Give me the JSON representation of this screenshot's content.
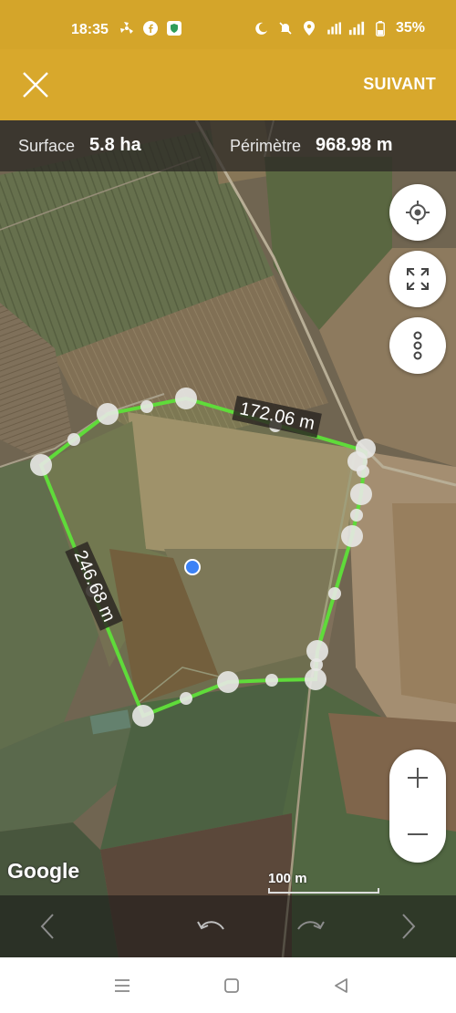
{
  "status_bar": {
    "time": "18:35",
    "battery": "35%",
    "icons_left": [
      "fan-icon",
      "facebook-icon",
      "shield-app-icon"
    ],
    "icons_right": [
      "moon-icon",
      "mute-icon",
      "location-icon",
      "wifi-signal-icon",
      "cell-signal-icon",
      "battery-icon"
    ]
  },
  "app_bar": {
    "next_label": "SUIVANT",
    "brand_color": "#d8a82c"
  },
  "info": {
    "surface_label": "Surface",
    "surface_value": "5.8 ha",
    "perimeter_label": "Périmètre",
    "perimeter_value": "968.98 m"
  },
  "map": {
    "segment_labels": [
      "172.06 m",
      "246.68 m"
    ],
    "polygon_color": "#5fdb3a",
    "google_label": "Google",
    "scale_label": "100 m"
  },
  "controls": {
    "locate_icon": "crosshair-icon",
    "fullscreen_icon": "expand-icon",
    "more_icon": "more-vertical-icon",
    "zoom_in": "+",
    "zoom_out": "−"
  },
  "toolbar": [
    "prev-icon",
    "undo-icon",
    "redo-icon",
    "next-icon"
  ],
  "nav": [
    "menu-icon",
    "home-icon",
    "back-icon"
  ]
}
